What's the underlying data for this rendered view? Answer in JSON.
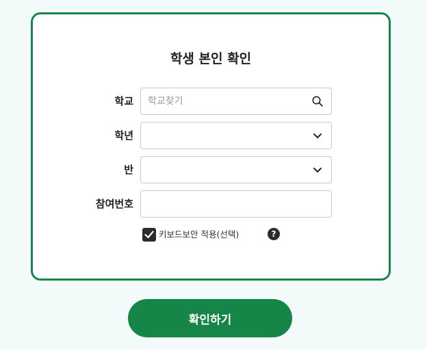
{
  "form": {
    "title": "학생 본인 확인",
    "fields": {
      "school": {
        "label": "학교",
        "placeholder": "학교찾기",
        "value": "",
        "icon": "search-icon"
      },
      "grade": {
        "label": "학년",
        "value": "",
        "icon": "chevron-down-icon"
      },
      "class": {
        "label": "반",
        "value": "",
        "icon": "chevron-down-icon"
      },
      "participant_number": {
        "label": "참여번호",
        "value": ""
      }
    },
    "keyboard_security": {
      "label": "키보드보안 적용(선택)",
      "checked": true,
      "help_icon": "help-icon"
    },
    "submit": {
      "label": "확인하기"
    }
  },
  "colors": {
    "accent": "#158548",
    "background": "#f3fbfa",
    "checkbox": "#2b2b2b"
  }
}
